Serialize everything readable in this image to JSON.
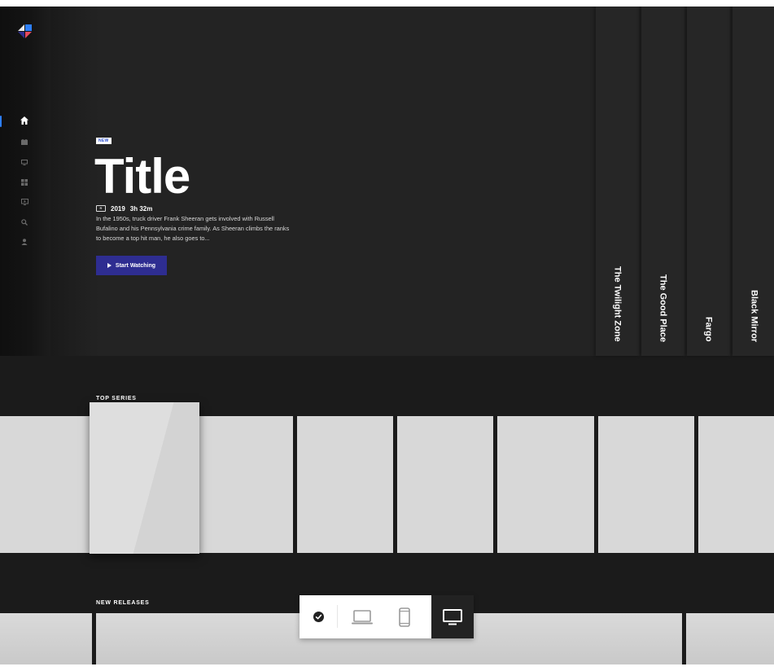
{
  "hero": {
    "badge": "NEW",
    "title": "Title",
    "rating": "R",
    "year": "2019",
    "runtime": "3h 32m",
    "description": "In the 1950s, truck driver Frank Sheeran gets involved with Russell Bufalino and his Pennsylvania crime family. As Sheeran climbs the ranks to become a top hit man, he also goes to...",
    "cta_label": "Start Watching"
  },
  "sidebar": {
    "items": [
      {
        "icon": "home-icon",
        "active": true
      },
      {
        "icon": "movies-icon",
        "active": false
      },
      {
        "icon": "tv-icon",
        "active": false
      },
      {
        "icon": "grid-icon",
        "active": false
      },
      {
        "icon": "live-icon",
        "active": false
      },
      {
        "icon": "search-icon",
        "active": false
      },
      {
        "icon": "profile-icon",
        "active": false
      }
    ]
  },
  "shelves": [
    "The Twilight Zone",
    "The Good Place",
    "Fargo",
    "Black Mirror"
  ],
  "sections": {
    "top_series": "TOP SERIES",
    "new_releases": "NEW RELEASES"
  },
  "device_bar": {
    "options": [
      "check-icon",
      "laptop-icon",
      "phone-icon",
      "tv-icon"
    ],
    "selected": "tv-icon"
  },
  "colors": {
    "accent": "#2d7ff9",
    "cta": "#2e2d91",
    "background": "#1b1b1b",
    "hero": "#232323",
    "card": "#d8d8d8"
  }
}
